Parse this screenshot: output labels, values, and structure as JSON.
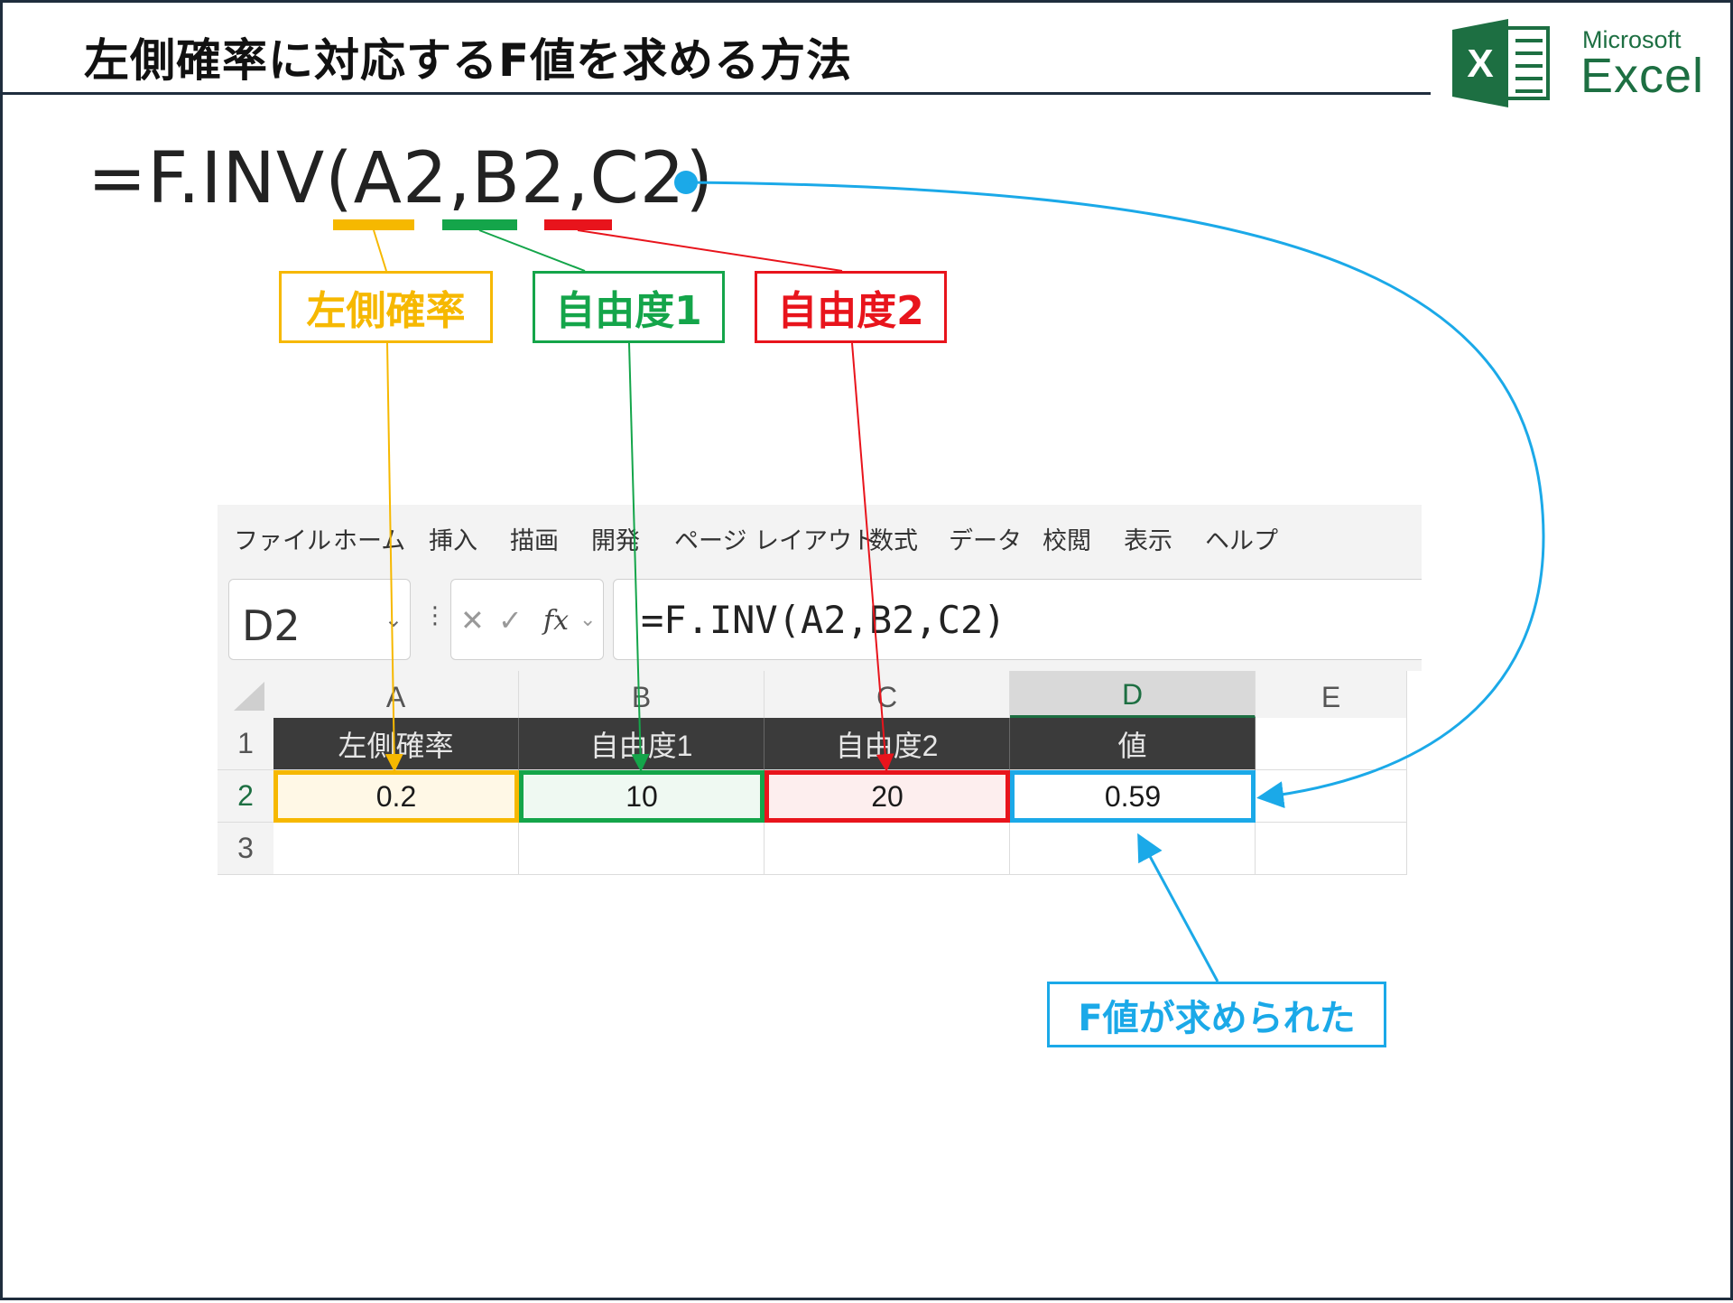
{
  "slide": {
    "title": "左側確率に対応するF値を求める方法"
  },
  "logo": {
    "microsoft": "Microsoft",
    "excel": "Excel",
    "letter": "X"
  },
  "formula": {
    "prefix": "=F.INV(",
    "arg1": "A2",
    "sep1": ",",
    "arg2": "B2",
    "sep2": ",",
    "arg3": "C2",
    "suffix": ")"
  },
  "labels": {
    "arg1": "左側確率",
    "arg2": "自由度1",
    "arg3": "自由度2",
    "result": "F値が求められた"
  },
  "ribbon": {
    "tabs": [
      "ファイル",
      "ホーム",
      "挿入",
      "描画",
      "開発",
      "ページ レイアウト",
      "数式",
      "データ",
      "校閲",
      "表示",
      "ヘルプ"
    ]
  },
  "formula_bar": {
    "name_box": "D2",
    "dropdown_glyph": "⌄",
    "dots": "⋮",
    "cancel_glyph": "✕",
    "enter_glyph": "✓",
    "fx_glyph": "fx",
    "fx_dropdown_glyph": "⌄",
    "content": "=F.INV(A2,B2,C2)"
  },
  "sheet": {
    "columns": [
      "A",
      "B",
      "C",
      "D",
      "E"
    ],
    "rows": [
      "1",
      "2",
      "3"
    ],
    "header_row": [
      "左側確率",
      "自由度1",
      "自由度2",
      "値"
    ],
    "data_row": [
      "0.2",
      "10",
      "20",
      "0.59"
    ],
    "selected_cell": "D2"
  },
  "colors": {
    "yellow": "#f6b800",
    "green": "#14a54a",
    "red": "#e8141c",
    "blue": "#1ba9e8",
    "excel_green": "#1d6f42"
  }
}
